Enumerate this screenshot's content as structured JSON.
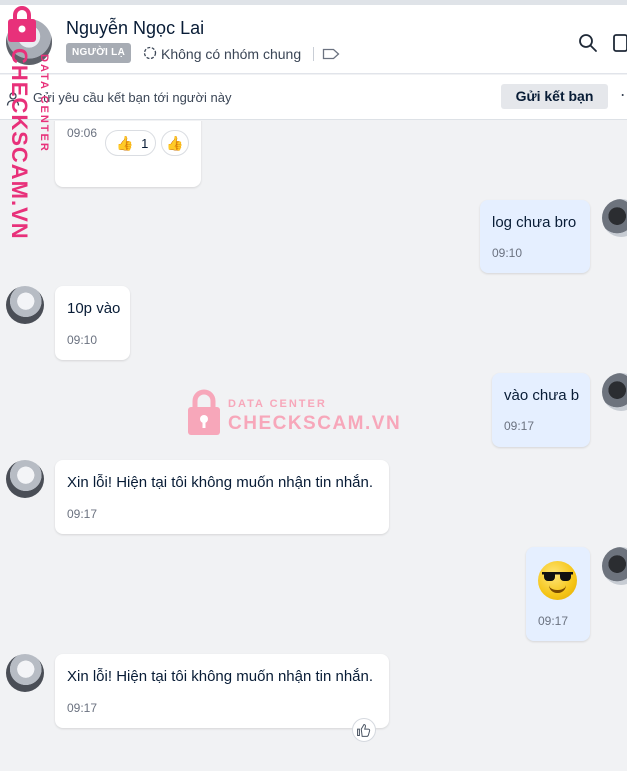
{
  "header": {
    "contact_name": "Nguyễn Ngọc Lai",
    "badge": "NGƯỜI LẠ",
    "group_status": "Không có nhóm chung"
  },
  "friend_bar": {
    "text": "Gửi yêu cầu kết bạn tới người này",
    "button": "Gửi kết bạn",
    "more": "⋯"
  },
  "messages": [
    {
      "sender": "them",
      "time": "09:06",
      "reactions": {
        "count": "1"
      }
    },
    {
      "sender": "me",
      "text": "log chưa bro",
      "time": "09:10"
    },
    {
      "sender": "them",
      "text": "10p vào",
      "time": "09:10"
    },
    {
      "sender": "me",
      "text": "vào chưa b",
      "time": "09:17"
    },
    {
      "sender": "them",
      "text": "Xin lỗi! Hiện tại tôi không muốn nhận tin nhắn.",
      "time": "09:17"
    },
    {
      "sender": "me",
      "emoji": "sunglasses-emoji",
      "time": "09:17"
    },
    {
      "sender": "them",
      "text": "Xin lỗi! Hiện tại tôi không muốn nhận tin nhắn.",
      "time": "09:17"
    }
  ],
  "watermark": {
    "small": "DATA CENTER",
    "big": "CHECKSCAM.VN"
  },
  "side_logo": {
    "big": "CHECKSCAM.VN",
    "small": "DATA CENTER"
  },
  "icons": {
    "search": "search-icon",
    "panel": "sidebar-toggle-icon",
    "tag": "tag-icon",
    "group": "group-icon",
    "add_friend": "add-friend-icon",
    "like": "thumbs-up-icon"
  },
  "colors": {
    "my_bubble": "#e5efff",
    "their_bubble": "#ffffff",
    "badge": "#a7acb4",
    "watermark": "#f7a7ba",
    "logo": "#e8317a"
  }
}
